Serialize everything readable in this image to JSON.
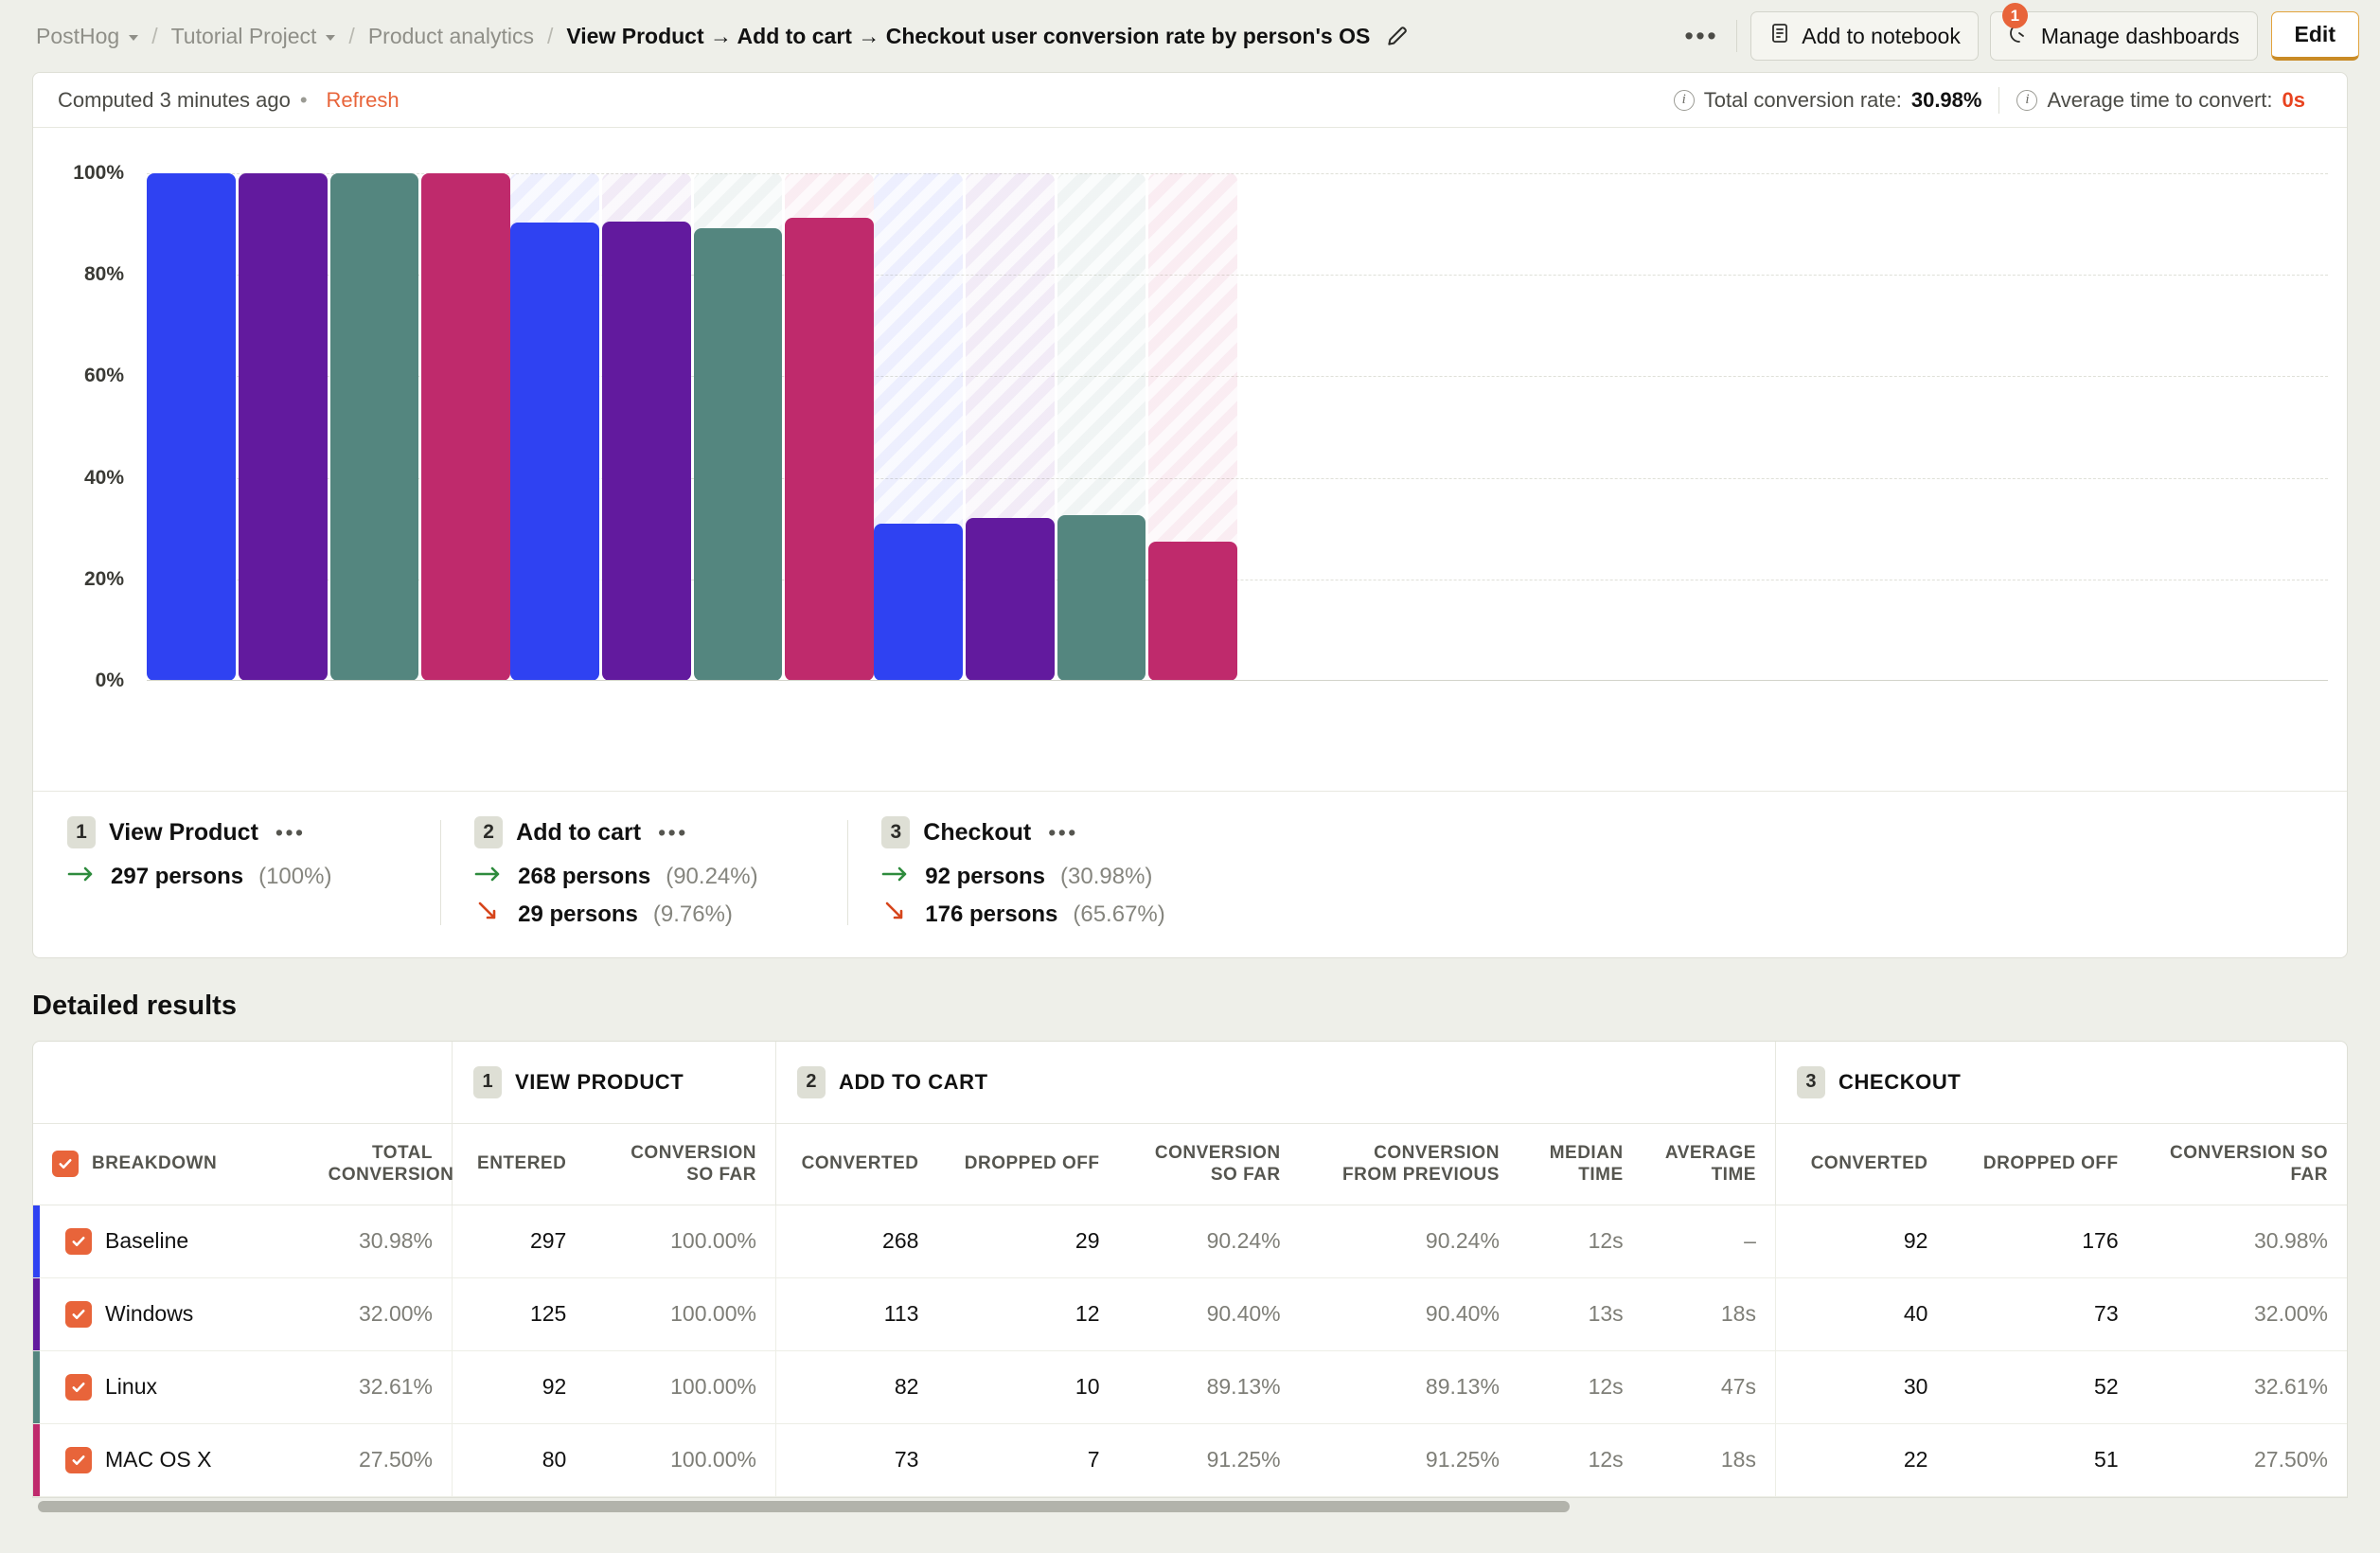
{
  "breadcrumb": {
    "items": [
      {
        "label": "PostHog",
        "has_chevron": true
      },
      {
        "label": "Tutorial Project",
        "has_chevron": true
      },
      {
        "label": "Product analytics",
        "has_chevron": false
      }
    ],
    "current": "View Product → Add to cart → Checkout user conversion rate by person's OS",
    "separator": "/",
    "edit_icon": "pencil-icon"
  },
  "toolbar": {
    "more_label": "•••",
    "add_to_notebook": "Add to notebook",
    "notebook_icon": "notebook-icon",
    "manage_dashboards": "Manage dashboards",
    "dashboards_icon": "dashboard-icon",
    "dashboards_badge": "1",
    "edit_label": "Edit"
  },
  "card_header": {
    "computed": "Computed 3 minutes ago",
    "separator": "•",
    "refresh": "Refresh",
    "total_conversion_label": "Total conversion rate:",
    "total_conversion_value": "30.98%",
    "avg_time_label": "Average time to convert:",
    "avg_time_value": "0s",
    "info_icon": "info-icon"
  },
  "colors": {
    "baseline": "#2F42F2",
    "windows": "#621A9E",
    "linux": "#54867F",
    "macosx": "#BF2A6C",
    "accent_orange": "#E8643A",
    "refresh_orange": "#E8643A",
    "green_arrow": "#2E8B3D",
    "red_arrow": "#D6451B"
  },
  "chart_data": {
    "type": "bar",
    "title": "",
    "xlabel": "",
    "ylabel": "",
    "ylim": [
      0,
      100
    ],
    "yticks": [
      "100%",
      "80%",
      "60%",
      "40%",
      "20%",
      "0%"
    ],
    "grid": true,
    "legend_position": "below",
    "categories": [
      "View Product",
      "Add to cart",
      "Checkout"
    ],
    "series": [
      {
        "name": "Baseline",
        "color": "#2F42F2",
        "values": [
          100.0,
          90.24,
          30.98
        ]
      },
      {
        "name": "Windows",
        "color": "#621A9E",
        "values": [
          100.0,
          90.4,
          32.0
        ]
      },
      {
        "name": "Linux",
        "color": "#54867F",
        "values": [
          100.0,
          89.13,
          32.61
        ]
      },
      {
        "name": "MAC OS X",
        "color": "#BF2A6C",
        "values": [
          100.0,
          91.25,
          27.5
        ]
      }
    ],
    "ghost_note": "striped remainder above each bar represents drop-off to 100%"
  },
  "steps": [
    {
      "num": "1",
      "name": "View Product",
      "dots": "•••",
      "converted_count": "297 persons",
      "converted_pct": "(100%)",
      "dropped_count": "",
      "dropped_pct": ""
    },
    {
      "num": "2",
      "name": "Add to cart",
      "dots": "•••",
      "converted_count": "268 persons",
      "converted_pct": "(90.24%)",
      "dropped_count": "29 persons",
      "dropped_pct": "(9.76%)"
    },
    {
      "num": "3",
      "name": "Checkout",
      "dots": "•••",
      "converted_count": "92 persons",
      "converted_pct": "(30.98%)",
      "dropped_count": "176 persons",
      "dropped_pct": "(65.67%)"
    }
  ],
  "detailed": {
    "title": "Detailed results",
    "group_headers": [
      {
        "num": "1",
        "label": "VIEW PRODUCT"
      },
      {
        "num": "2",
        "label": "ADD TO CART"
      },
      {
        "num": "3",
        "label": "CHECKOUT"
      }
    ],
    "columns": {
      "breakdown": "BREAKDOWN",
      "total_conversion": "TOTAL\nCONVERSION",
      "entered": "ENTERED",
      "conversion_so_far_1": "CONVERSION\nSO FAR",
      "converted_2": "CONVERTED",
      "dropped_off_2": "DROPPED OFF",
      "conversion_so_far_2": "CONVERSION\nSO FAR",
      "conversion_from_previous": "CONVERSION\nFROM PREVIOUS",
      "median_time": "MEDIAN\nTIME",
      "average_time": "AVERAGE\nTIME",
      "converted_3": "CONVERTED",
      "dropped_off_3": "DROPPED OFF",
      "conversion_so_far_3": "CONVERSION\nSO FAR"
    },
    "rows": [
      {
        "name": "Baseline",
        "stripe": "#2F42F2",
        "checked": true,
        "total_conversion": "30.98%",
        "entered": "297",
        "conv_so_far_1": "100.00%",
        "converted_2": "268",
        "dropped_2": "29",
        "conv_so_far_2": "90.24%",
        "conv_from_prev": "90.24%",
        "median_time": "12s",
        "average_time": "–",
        "converted_3": "92",
        "dropped_3": "176",
        "conv_so_far_3": "30.98%"
      },
      {
        "name": "Windows",
        "stripe": "#621A9E",
        "checked": true,
        "total_conversion": "32.00%",
        "entered": "125",
        "conv_so_far_1": "100.00%",
        "converted_2": "113",
        "dropped_2": "12",
        "conv_so_far_2": "90.40%",
        "conv_from_prev": "90.40%",
        "median_time": "13s",
        "average_time": "18s",
        "converted_3": "40",
        "dropped_3": "73",
        "conv_so_far_3": "32.00%"
      },
      {
        "name": "Linux",
        "stripe": "#54867F",
        "checked": true,
        "total_conversion": "32.61%",
        "entered": "92",
        "conv_so_far_1": "100.00%",
        "converted_2": "82",
        "dropped_2": "10",
        "conv_so_far_2": "89.13%",
        "conv_from_prev": "89.13%",
        "median_time": "12s",
        "average_time": "47s",
        "converted_3": "30",
        "dropped_3": "52",
        "conv_so_far_3": "32.61%"
      },
      {
        "name": "MAC OS X",
        "stripe": "#BF2A6C",
        "checked": true,
        "total_conversion": "27.50%",
        "entered": "80",
        "conv_so_far_1": "100.00%",
        "converted_2": "73",
        "dropped_2": "7",
        "conv_so_far_2": "91.25%",
        "conv_from_prev": "91.25%",
        "median_time": "12s",
        "average_time": "18s",
        "converted_3": "22",
        "dropped_3": "51",
        "conv_so_far_3": "27.50%"
      }
    ]
  }
}
